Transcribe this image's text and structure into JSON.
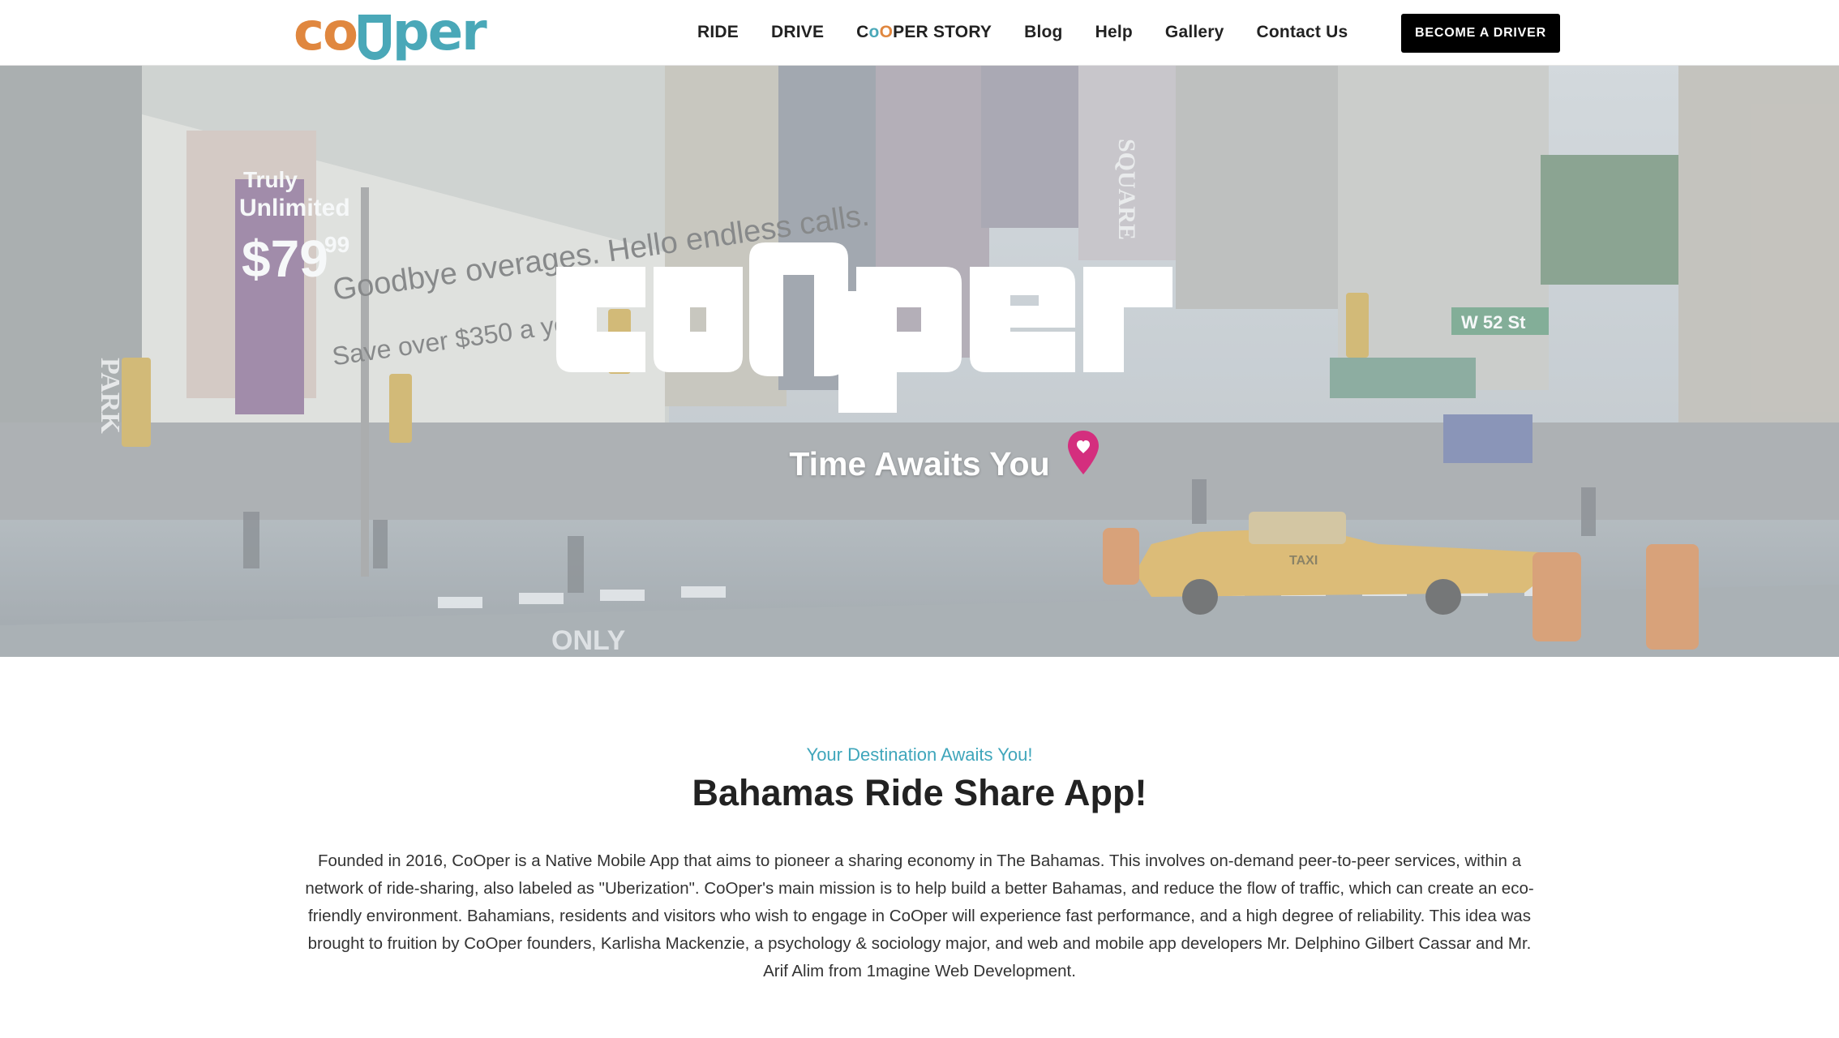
{
  "header": {
    "logo_alt": "CoOper",
    "nav": [
      {
        "label": "RIDE"
      },
      {
        "label": "DRIVE"
      },
      {
        "label_prefix": "C",
        "label_o1": "o",
        "label_o2": "O",
        "label_rest": "PER STORY"
      },
      {
        "label": "Blog"
      },
      {
        "label": "Help"
      },
      {
        "label": "Gallery"
      },
      {
        "label": "Contact Us"
      }
    ],
    "cta_label": "BECOME A DRIVER"
  },
  "hero": {
    "tagline": "Time Awaits You",
    "pin_icon": "map-pin-icon",
    "billboard_text": {
      "line1": "Truly",
      "line2": "Unlimited",
      "price": "$79",
      "cents": "99",
      "goodbye": "Goodbye overages. Hello endless calls.",
      "save": "Save over $350 a year.",
      "park": "PARK",
      "street_sign": "W 52 St",
      "square": "SQUARE",
      "taxi": "TAXI",
      "only": "ONLY"
    }
  },
  "about": {
    "kicker": "Your Destination Awaits You!",
    "title": "Bahamas Ride Share App!",
    "body": "Founded in 2016, CoOper is a Native Mobile App that aims to pioneer a sharing economy in The Bahamas. This involves on-demand peer-to-peer services, within a network of ride-sharing, also labeled as \"Uberization\". CoOper's main mission is to help build a better Bahamas, and reduce the flow of traffic, which can create an eco-friendly environment. Bahamians, residents and visitors who wish to engage in CoOper will experience fast performance, and a high degree of reliability. This idea was brought to fruition by CoOper founders, Karlisha Mackenzie, a psychology & sociology major, and web and mobile app developers Mr. Delphino Gilbert Cassar and Mr. Arif Alim from 1magine Web Development."
  },
  "colors": {
    "brand_orange": "#e0873f",
    "brand_teal": "#4aa8b8",
    "kicker_teal": "#3fa6bb",
    "pin_magenta": "#d42e7e",
    "cta_bg": "#000000"
  }
}
